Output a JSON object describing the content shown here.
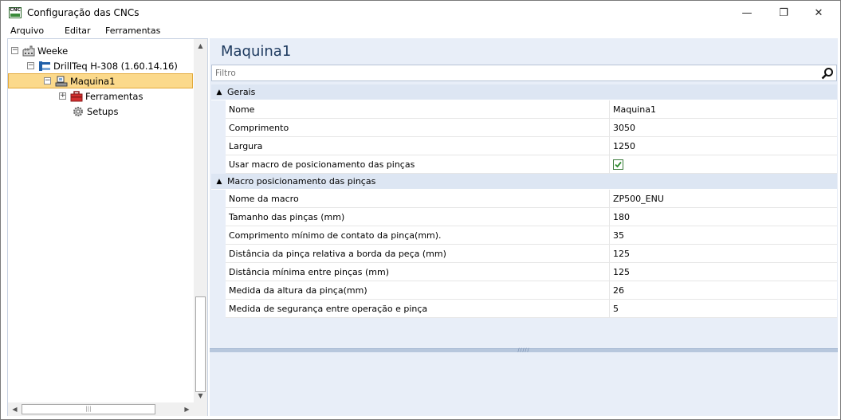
{
  "window": {
    "title": "Configuração das CNCs",
    "icon": "cnc-app-icon",
    "icon_label": "CNC",
    "controls": {
      "minimize": "—",
      "maximize": "❐",
      "close": "✕"
    }
  },
  "menu": {
    "items": [
      {
        "label": "Arquivo"
      },
      {
        "label": "Editar"
      },
      {
        "label": "Ferramentas"
      }
    ]
  },
  "tree": {
    "items": [
      {
        "label": "Weeke",
        "expander": "−",
        "icon": "factory-icon"
      },
      {
        "label": "DrillTeq H-308 (1.60.14.16)",
        "expander": "−",
        "icon": "machine-icon"
      },
      {
        "label": "Maquina1",
        "expander": "−",
        "icon": "machine-node-icon",
        "selected": true
      },
      {
        "label": "Ferramentas",
        "expander": "+",
        "icon": "toolbox-icon"
      },
      {
        "label": "Setups",
        "icon": "gear-icon"
      }
    ]
  },
  "scrollbars": {
    "up": "▲",
    "down": "▼",
    "left": "◀",
    "right": "▶",
    "thumb_grip": "|||"
  },
  "details": {
    "title": "Maquina1",
    "filter_placeholder": "Filtro",
    "groups": [
      {
        "label": "Gerais",
        "chevron": "▲",
        "rows": [
          {
            "name": "Nome",
            "value": "Maquina1"
          },
          {
            "name": "Comprimento",
            "value": "3050"
          },
          {
            "name": "Largura",
            "value": "1250"
          },
          {
            "name": "Usar macro de posicionamento das pinças",
            "checked": true
          }
        ]
      },
      {
        "label": "Macro posicionamento das pinças",
        "chevron": "▲",
        "rows": [
          {
            "name": "Nome da macro",
            "value": "ZP500_ENU"
          },
          {
            "name": "Tamanho das pinças (mm)",
            "value": "180"
          },
          {
            "name": "Comprimento mínimo de contato da pinça(mm).",
            "value": "35"
          },
          {
            "name": "Distância da pinça relativa a borda da peça (mm)",
            "value": "125"
          },
          {
            "name": "Distância mínima entre pinças (mm)",
            "value": "125"
          },
          {
            "name": "Medida da altura da pinça(mm)",
            "value": "26"
          },
          {
            "name": "Medida de segurança entre operação e pinça",
            "value": "5"
          }
        ]
      }
    ],
    "splitter_grip": "/////"
  },
  "colors": {
    "selection_fill": "#fbd98b",
    "selection_border": "#e3a93a",
    "panel_background": "#e8eef8",
    "group_header": "#dde6f3",
    "title_text": "#1e3a5f",
    "checkbox_check": "#2e8b2e"
  }
}
